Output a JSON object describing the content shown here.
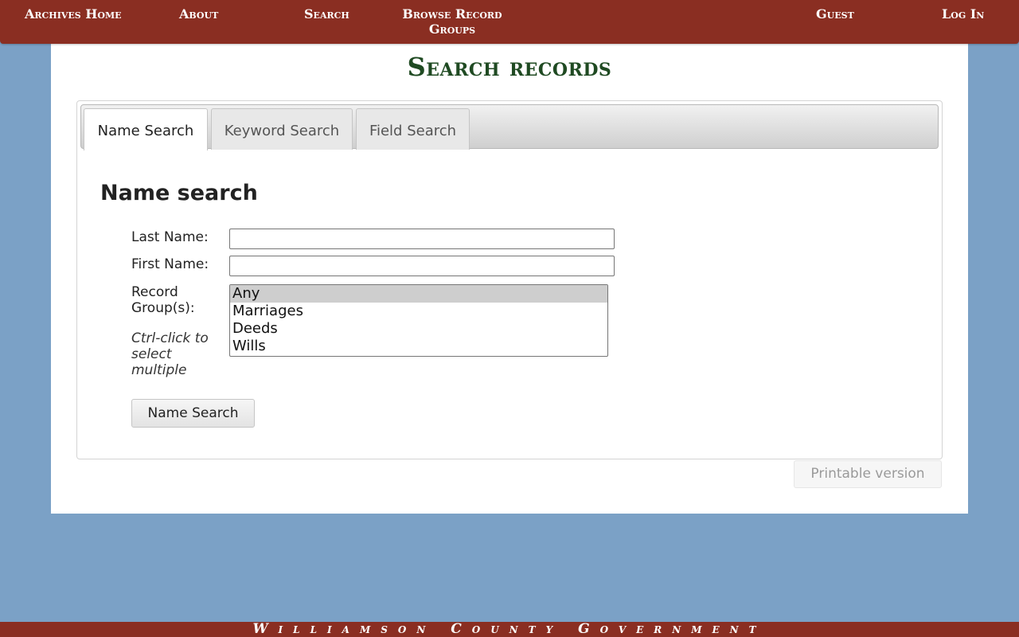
{
  "nav": {
    "archives_home": "Archives Home",
    "about": "About",
    "search": "Search",
    "browse_line1": "Browse Record",
    "browse_line2": "Groups",
    "guest": "Guest",
    "login": "Log In"
  },
  "page_title": "Search records",
  "tabs": [
    {
      "label": "Name Search",
      "active": true
    },
    {
      "label": "Keyword Search",
      "active": false
    },
    {
      "label": "Field Search",
      "active": false
    }
  ],
  "form": {
    "heading": "Name search",
    "last_name_label": "Last Name:",
    "last_name_value": "",
    "first_name_label": "First Name:",
    "first_name_value": "",
    "record_groups_label_line1": "Record",
    "record_groups_label_line2": "Group(s):",
    "hint_line1": "Ctrl-click to",
    "hint_line2": "select",
    "hint_line3": "multiple",
    "record_group_options": [
      "Any",
      "Marriages",
      "Deeds",
      "Wills"
    ],
    "selected_option": "Any",
    "submit_label": "Name Search"
  },
  "printable_label": "Printable version",
  "footer_text": "Williamson County Government",
  "colors": {
    "header_bg": "#8a2e22",
    "page_bg": "#7ba1c6",
    "title_green": "#1f4a22"
  }
}
